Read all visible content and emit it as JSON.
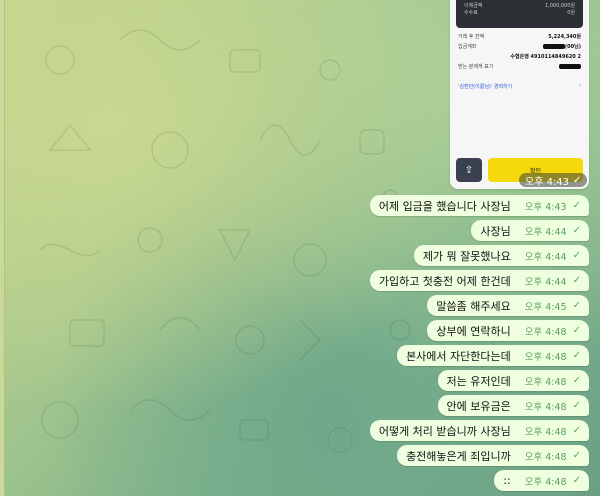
{
  "screenshot_message": {
    "top_rows": [
      {
        "label": "이체금액",
        "value": "1,000,000원"
      },
      {
        "label": "수수료",
        "value": "0원"
      }
    ],
    "body_rows": [
      {
        "label": "거래 후 잔액",
        "value": "5,224,340원"
      },
      {
        "label": "입금계좌",
        "value": "(00님)"
      },
      {
        "label": "",
        "value": "수협은행 4910114849620 2"
      },
      {
        "label": "받는 분에게 표기",
        "value": ""
      }
    ],
    "link_text": "'김환민(이름님)' 경력하기",
    "share_icon": "share-icon",
    "confirm_label": "확인",
    "time": "오후 4:43"
  },
  "messages": [
    {
      "text": "어제 입금을 했습니다 사장님",
      "time": "오후 4:43"
    },
    {
      "text": "사장님",
      "time": "오후 4:44"
    },
    {
      "text": "제가 뭐 잘못했나요",
      "time": "오후 4:44"
    },
    {
      "text": "가입하고 첫충전 어제 한건데",
      "time": "오후 4:44"
    },
    {
      "text": "말씀좀 해주세요",
      "time": "오후 4:45"
    },
    {
      "text": "상부에 연락하니",
      "time": "오후 4:48"
    },
    {
      "text": "본사에서 자단한다는데",
      "time": "오후 4:48"
    },
    {
      "text": "저는 유저인데",
      "time": "오후 4:48"
    },
    {
      "text": "안에 보유금은",
      "time": "오후 4:48"
    },
    {
      "text": "어떻게 처리 받습니까 사장님",
      "time": "오후 4:48"
    },
    {
      "text": "충전해놓은게 죄입니까",
      "time": "오후 4:48"
    },
    {
      "text": "::",
      "time": "오후 4:48"
    }
  ],
  "colors": {
    "bubble": "#eefedf",
    "time": "#5aa25e",
    "confirm": "#f5d90a"
  }
}
